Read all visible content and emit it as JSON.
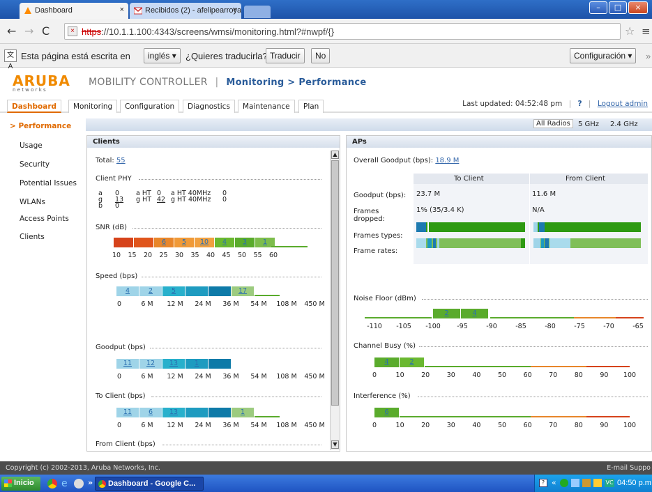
{
  "colors": {
    "accent": "#2a5c9a",
    "orange": "#e8862a",
    "red": "#d6431b",
    "green": "#5aab2c",
    "teal": "#1e9bc0",
    "lightblue": "#9fd4e8"
  },
  "browser": {
    "tabs": [
      {
        "label": "Dashboard",
        "close": "×"
      },
      {
        "label": "Recibidos (2) - afelipearroya ",
        "close": "×"
      }
    ],
    "url": "https://10.1.1.100:4343/screens/wmsi/monitoring.html?#nwpf/{}",
    "url_scheme": "https",
    "url_rest": "://10.1.1.100:4343/screens/wmsi/monitoring.html?#nwpf/{}",
    "win_min": "–",
    "win_max": "□",
    "win_close": "×"
  },
  "translate": {
    "prefix": "Esta página está escrita en",
    "lang": "inglés ▾",
    "question": "¿Quieres traducirla?",
    "translate_btn": "Traducir",
    "no_btn": "No",
    "config_btn": "Configuración ▾",
    "more": "»"
  },
  "header": {
    "logo_top": "ARUBA",
    "logo_bottom": "n e t w o r k s",
    "product": "MOBILITY CONTROLLER",
    "sep": "|",
    "crumb": "Monitoring > Performance"
  },
  "nav": {
    "tabs": [
      "Dashboard",
      "Monitoring",
      "Configuration",
      "Diagnostics",
      "Maintenance",
      "Plan"
    ],
    "last_updated": "Last updated: 04:52:48 pm",
    "help": "?",
    "logout": "Logout admin"
  },
  "sidebar": [
    {
      "label": "> Performance"
    },
    {
      "label": "Usage"
    },
    {
      "label": "Security"
    },
    {
      "label": "Potential Issues"
    },
    {
      "label": "WLANs"
    },
    {
      "label": "Access Points"
    },
    {
      "label": "Clients"
    }
  ],
  "radios": [
    "All Radios",
    "5 GHz",
    "2.4 GHz"
  ],
  "clients": {
    "title": "Clients",
    "total_label": "Total:",
    "total": "55",
    "phy_title": "Client PHY",
    "phy": [
      [
        "a",
        "0",
        "a HT",
        "0",
        "a HT 40MHz",
        "0"
      ],
      [
        "g",
        "13",
        "g HT",
        "42",
        "g HT 40MHz",
        "0"
      ],
      [
        "b",
        "0",
        "",
        "",
        "",
        ""
      ]
    ],
    "snr_title": "SNR (dB)",
    "snr_bars": [
      "",
      "",
      "6",
      "5",
      "10",
      "4",
      "3",
      "1"
    ],
    "snr_ticks": [
      "10",
      "15",
      "20",
      "25",
      "30",
      "35",
      "40",
      "45",
      "50",
      "55",
      "60"
    ],
    "speed_title": "Speed (bps)",
    "speed_bars": [
      "4",
      "2",
      "5",
      "",
      "",
      "17"
    ],
    "rate_ticks": [
      "0",
      "6 M",
      "12 M",
      "24 M",
      "36 M",
      "54 M",
      "108 M",
      "450 M"
    ],
    "goodput_title": "Goodput (bps)",
    "goodput_bars": [
      "11",
      "12",
      "13",
      "1",
      ""
    ],
    "toclient_title": "To Client (bps)",
    "toclient_bars": [
      "11",
      "6",
      "13",
      "",
      "",
      "1"
    ],
    "fromclient_title": "From Client (bps)"
  },
  "aps": {
    "title": "APs",
    "overall_label": "Overall Goodput (bps):",
    "overall": "18.9 M",
    "col_to": "To Client",
    "col_from": "From Client",
    "goodput_label": "Goodput (bps):",
    "goodput_to": "23.7 M",
    "goodput_from": "11.6 M",
    "frames_dropped_label": "Frames dropped:",
    "frames_dropped_to": "1% (35/3.4 K)",
    "frames_dropped_from": "N/A",
    "frame_types_label": "Frames types:",
    "frame_rates_label": "Frame rates:",
    "noise_title": "Noise Floor (dBm)",
    "noise_bars": [
      "2",
      "4"
    ],
    "noise_ticks": [
      "-110",
      "-105",
      "-100",
      "-95",
      "-90",
      "-85",
      "-80",
      "-75",
      "-70",
      "-65"
    ],
    "busy_title": "Channel Busy (%)",
    "busy_bars": [
      "4",
      "2"
    ],
    "pct_ticks": [
      "0",
      "10",
      "20",
      "30",
      "40",
      "50",
      "60",
      "70",
      "80",
      "90",
      "100"
    ],
    "interf_title": "Interference (%)",
    "interf_bars": [
      "6"
    ]
  },
  "footer": {
    "copyright": "Copyright (c) 2002-2013, Aruba Networks, Inc.",
    "email": "E-mail Suppo"
  },
  "taskbar": {
    "start": "Inicio",
    "quick": "»",
    "task": "Dashboard - Google C...",
    "tray_extra": "«",
    "clock": "04:50 p.m"
  }
}
